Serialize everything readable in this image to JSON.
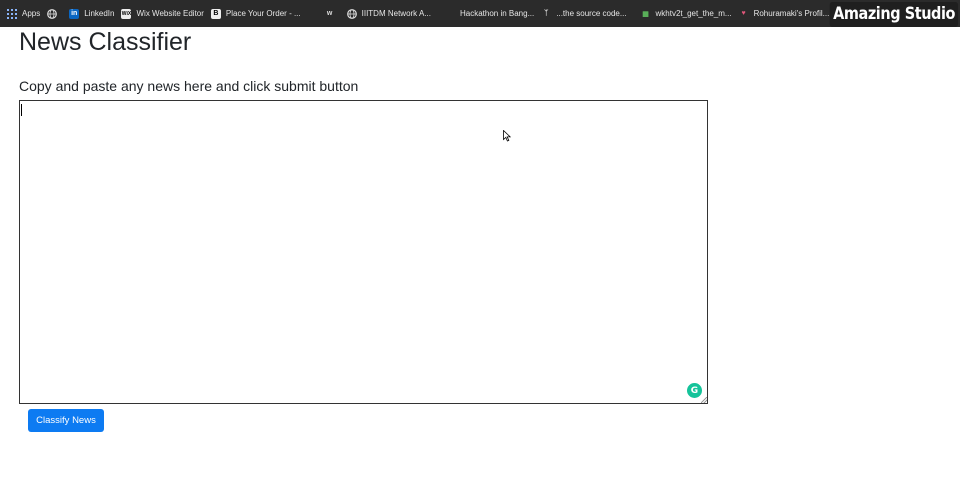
{
  "bookmarks_bar": {
    "items": [
      {
        "label": "Apps",
        "icon": "apps-grid-icon"
      },
      {
        "label": "",
        "icon": "globe-icon"
      },
      {
        "label": "LinkedIn",
        "icon": "linkedin-icon"
      },
      {
        "label": "Wix Website Editor",
        "icon": "wix-icon"
      },
      {
        "label": "Place Your Order - ...",
        "icon": "b-icon"
      },
      {
        "label": "",
        "icon": "w-icon"
      },
      {
        "label": "IIITDM Network A...",
        "icon": "globe-icon"
      },
      {
        "label": "Hackathon in Bang...",
        "icon": "blank-icon"
      },
      {
        "label": "...the source code...",
        "icon": "fork-icon"
      },
      {
        "label": "wkhtv2t_get_the_m...",
        "icon": "grid-icon"
      },
      {
        "label": "Rohuramaki's Profil...",
        "icon": "heart-icon"
      },
      {
        "label": "",
        "icon": "github-icon"
      }
    ],
    "colors": {
      "background": "#2b2b2b",
      "text": "#e6e6e6"
    }
  },
  "watermark": {
    "text": "Amazing Studio"
  },
  "page": {
    "title": "News Classifier",
    "instruction": "Copy and paste any news here and click submit button",
    "news_input": {
      "value": "",
      "placeholder": ""
    },
    "grammarly_icon": "grammarly-icon",
    "submit_button": {
      "label": "Classify News",
      "color": "#0d7bf2"
    }
  }
}
